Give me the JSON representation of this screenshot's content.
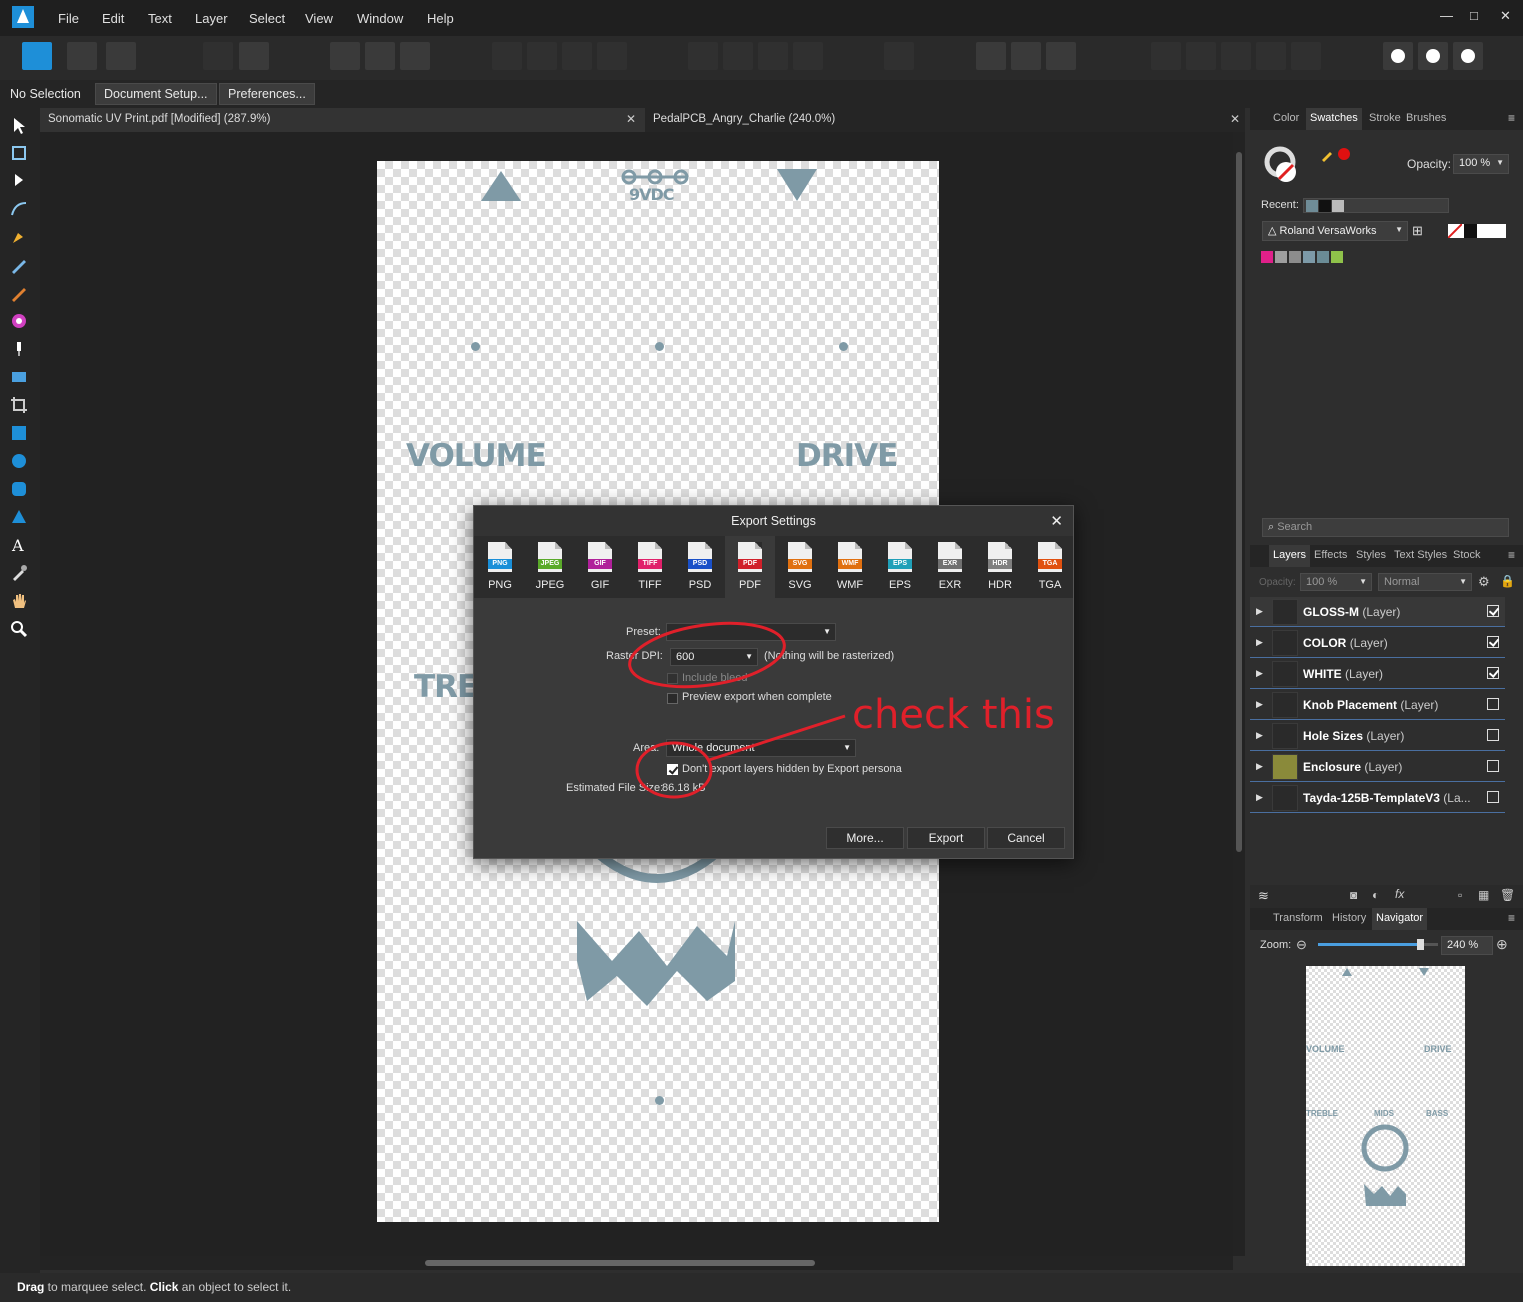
{
  "menu": [
    "File",
    "Edit",
    "Text",
    "Layer",
    "Select",
    "View",
    "Window",
    "Help"
  ],
  "window_controls": {
    "minimize": "—",
    "restore": "□",
    "close": "✕"
  },
  "context": {
    "selection": "No Selection",
    "document_setup": "Document Setup...",
    "preferences": "Preferences..."
  },
  "doc_tabs": [
    {
      "label": "Sonomatic UV Print.pdf [Modified] (287.9%)",
      "close": "✕"
    },
    {
      "label": "PedalPCB_Angry_Charlie (240.0%)",
      "close": "✕"
    }
  ],
  "artwork": {
    "power": "9VDC",
    "volume": "VOLUME",
    "drive": "DRIVE",
    "treble_partial": "TRE"
  },
  "status": {
    "drag": "Drag",
    "drag_rest": " to marquee select. ",
    "click": "Click",
    "click_rest": " an object to select it."
  },
  "swatches_panel": {
    "tabs": [
      "Color",
      "Swatches",
      "Stroke",
      "Brushes"
    ],
    "active_tab": "Swatches",
    "opacity_label": "Opacity:",
    "opacity_value": "100 %",
    "recent_label": "Recent:",
    "palette": "Roland VersaWorks",
    "palette_colors": [
      "#e0208a",
      "#9e9e9e",
      "#8c8c8c",
      "#7d9aa8",
      "#6b8c96",
      "#8fc24a"
    ],
    "recent_colors": [
      "#6f8c97",
      "#111111",
      "#bbbbbb"
    ]
  },
  "layers_panel": {
    "search_placeholder": "Search",
    "tabs": [
      "Layers",
      "Effects",
      "Styles",
      "Text Styles",
      "Stock"
    ],
    "active_tab": "Layers",
    "opacity_label": "Opacity:",
    "opacity_value": "100 %",
    "blend_mode": "Normal",
    "layers": [
      {
        "name": "GLOSS-M",
        "type": "(Layer)",
        "visible": true
      },
      {
        "name": "COLOR",
        "type": "(Layer)",
        "visible": true
      },
      {
        "name": "WHITE",
        "type": "(Layer)",
        "visible": true
      },
      {
        "name": "Knob Placement",
        "type": "(Layer)",
        "visible": false
      },
      {
        "name": "Hole Sizes",
        "type": "(Layer)",
        "visible": false
      },
      {
        "name": "Enclosure",
        "type": "(Layer)",
        "visible": false
      },
      {
        "name": "Tayda-125B-TemplateV3",
        "type": "(La...",
        "visible": false
      }
    ]
  },
  "navigator_panel": {
    "tabs": [
      "Transform",
      "History",
      "Navigator"
    ],
    "active_tab": "Navigator",
    "zoom_label": "Zoom:",
    "zoom_value": "240 %",
    "zoom_fraction": 0.85,
    "preview_labels": [
      "VOLUME",
      "DRIVE",
      "TREBLE",
      "MIDS",
      "BASS"
    ]
  },
  "dialog": {
    "title": "Export Settings",
    "close": "✕",
    "formats": [
      {
        "label": "PNG",
        "color": "#1a8fd8"
      },
      {
        "label": "JPEG",
        "color": "#5aaa2a"
      },
      {
        "label": "GIF",
        "color": "#b0209a"
      },
      {
        "label": "TIFF",
        "color": "#e0206a"
      },
      {
        "label": "PSD",
        "color": "#1a50c8"
      },
      {
        "label": "PDF",
        "color": "#d0202a"
      },
      {
        "label": "SVG",
        "color": "#e07010"
      },
      {
        "label": "WMF",
        "color": "#e07010"
      },
      {
        "label": "EPS",
        "color": "#20a0b8"
      },
      {
        "label": "EXR",
        "color": "#707070"
      },
      {
        "label": "HDR",
        "color": "#808080"
      },
      {
        "label": "TGA",
        "color": "#e05010"
      }
    ],
    "active_format": "PDF",
    "preset_label": "Preset:",
    "preset_value": "",
    "dpi_label": "Raster DPI:",
    "dpi_value": "600",
    "dpi_note": "(Nothing will be rasterized)",
    "include_bleed": "Include bleed",
    "preview_export": "Preview export when complete",
    "area_label": "Area:",
    "area_value": "Whole document",
    "dont_export_hidden": "Don't export layers hidden by Export persona",
    "file_size_label": "Estimated File Size:",
    "file_size_value": "86.18 kB",
    "buttons": {
      "more": "More...",
      "export": "Export",
      "cancel": "Cancel"
    }
  },
  "annotation": {
    "text": "check this",
    "color": "#e0202a"
  }
}
